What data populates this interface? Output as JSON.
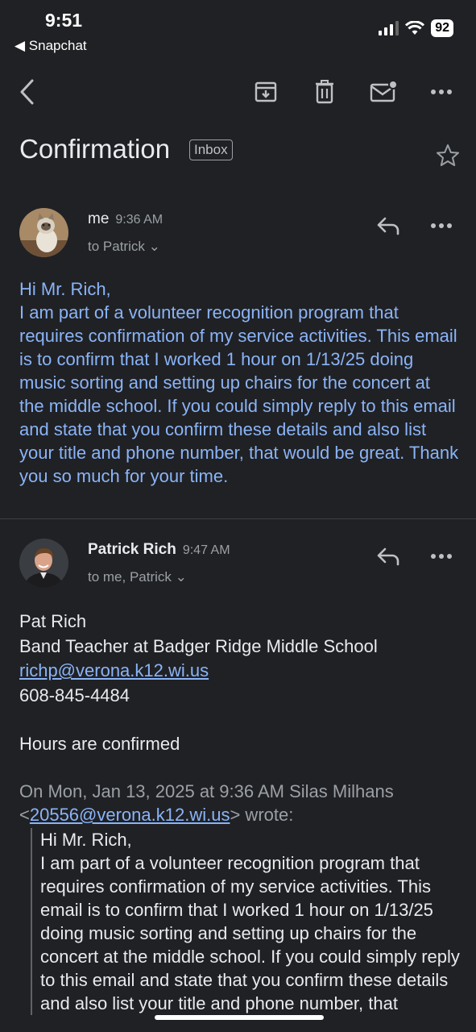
{
  "status_bar": {
    "time": "9:51",
    "back_app": "◀ Snapchat",
    "battery": "92"
  },
  "toolbar": {
    "back_icon": "chevron-left-icon",
    "archive_icon": "archive-icon",
    "delete_icon": "trash-icon",
    "mark_unread_icon": "mail-unread-icon",
    "more_icon": "more-horizontal-icon"
  },
  "subject": {
    "title": "Confirmation",
    "label": "Inbox"
  },
  "messages": [
    {
      "sender": "me",
      "time": "9:36 AM",
      "to": "to Patrick ⌄",
      "body": "Hi Mr. Rich,\nI am part of a volunteer recognition program that requires confirmation of my service activities. This email is to confirm that I worked 1 hour on 1/13/25 doing music sorting and setting up chairs for the concert at the middle school. If you could simply reply to this email and state that you confirm these details and also list your title and phone number, that would be great. Thank you so much for your time."
    },
    {
      "sender": "Patrick Rich",
      "time": "9:47 AM",
      "to": "to me, Patrick ⌄",
      "sig_name": "Pat Rich",
      "sig_title": "Band Teacher at Badger Ridge Middle School",
      "sig_email": "richp@verona.k12.wi.us",
      "sig_phone": "608-845-4484",
      "reply_text": "Hours are confirmed",
      "quote_prefix": "On Mon, Jan 13, 2025 at 9:36 AM Silas Milhans",
      "quote_lt": "<",
      "quote_email": "20556@verona.k12.wi.us",
      "quote_suffix": "> wrote:",
      "quoted_body": "Hi Mr. Rich,\nI am part of a volunteer recognition program that requires confirmation of my service activities. This email is to confirm that I worked 1 hour on 1/13/25 doing music sorting and setting up chairs for the concert at the middle school. If you could simply reply to this email and state that you confirm these details and also list your title and phone number, that"
    }
  ]
}
